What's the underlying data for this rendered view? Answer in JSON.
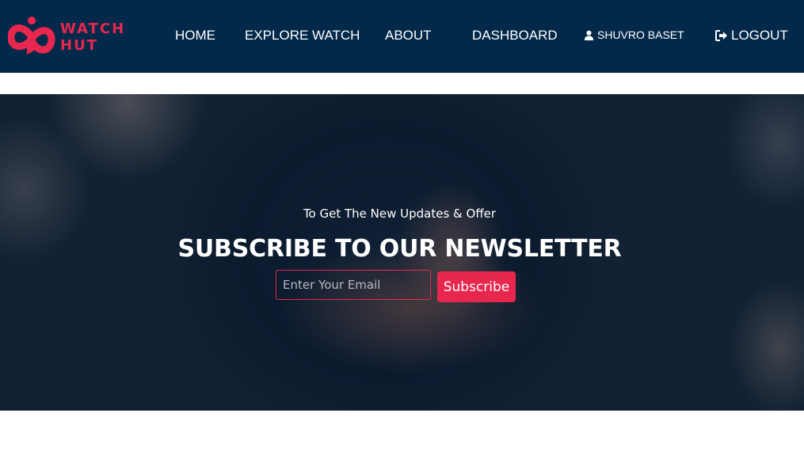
{
  "brand": {
    "name_line1": "WATCH",
    "name_line2": "HUT",
    "logo_icon": "infinity-play-logo",
    "accent_color": "#e8274f"
  },
  "navbar": {
    "background": "#03294a",
    "items": [
      {
        "label": "HOME"
      },
      {
        "label": "EXPLORE WATCH"
      },
      {
        "label": "ABOUT"
      },
      {
        "label": "DASHBOARD"
      }
    ],
    "user": {
      "icon": "user-icon",
      "name": "SHUVRO BASET"
    },
    "logout": {
      "icon": "sign-out-icon",
      "label": "LOGOUT"
    }
  },
  "newsletter": {
    "subtitle": "To Get The New Updates & Offer",
    "title": "SUBSCRIBE TO OUR NEWSLETTER",
    "email_placeholder": "Enter Your Email",
    "email_value": "",
    "button_label": "Subscribe"
  }
}
